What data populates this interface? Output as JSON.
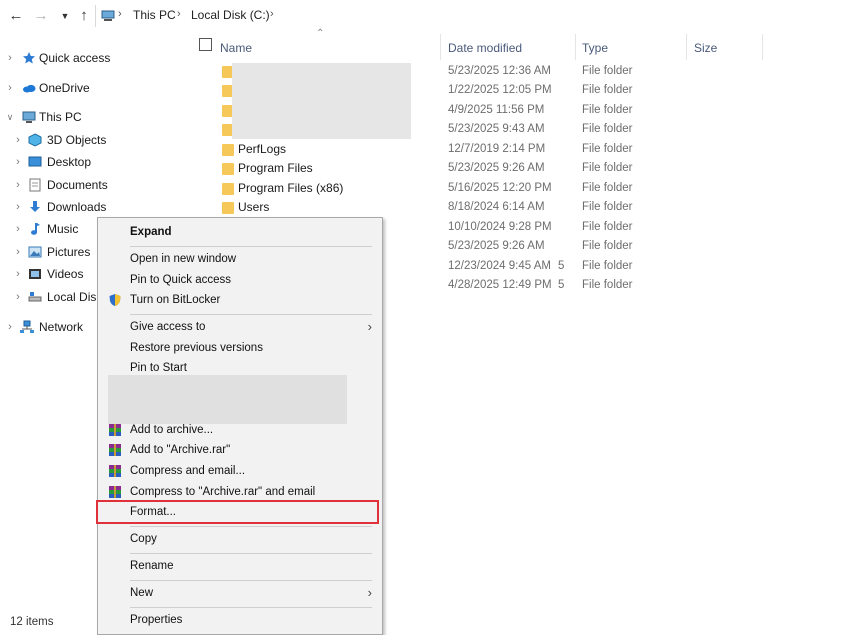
{
  "address": {
    "crumbs": [
      "This PC",
      "Local Disk (C:)"
    ]
  },
  "nav": {
    "items": [
      {
        "label": "Quick access",
        "icon": "star-icon"
      },
      {
        "label": "OneDrive",
        "icon": "cloud-icon"
      },
      {
        "label": "This PC",
        "icon": "computer-icon"
      },
      {
        "label": "3D Objects",
        "icon": "cube-icon"
      },
      {
        "label": "Desktop",
        "icon": "desktop-icon"
      },
      {
        "label": "Documents",
        "icon": "document-icon"
      },
      {
        "label": "Downloads",
        "icon": "download-icon"
      },
      {
        "label": "Music",
        "icon": "music-icon"
      },
      {
        "label": "Pictures",
        "icon": "picture-icon"
      },
      {
        "label": "Videos",
        "icon": "video-icon"
      },
      {
        "label": "Local Disk",
        "icon": "drive-icon"
      },
      {
        "label": "Network",
        "icon": "network-icon"
      }
    ]
  },
  "status": {
    "items_count": "12 items"
  },
  "columns": {
    "name": "Name",
    "date": "Date modified",
    "type": "Type",
    "size": "Size"
  },
  "rows": [
    {
      "name": "",
      "date": "5/23/2025 12:36 AM",
      "type": "File folder"
    },
    {
      "name": "",
      "date": "1/22/2025 12:05 PM",
      "type": "File folder"
    },
    {
      "name": "",
      "date": "4/9/2025 11:56 PM",
      "type": "File folder"
    },
    {
      "name": "",
      "date": "5/23/2025 9:43 AM",
      "type": "File folder"
    },
    {
      "name": "PerfLogs",
      "date": "12/7/2019 2:14 PM",
      "type": "File folder"
    },
    {
      "name": "Program Files",
      "date": "5/23/2025 9:26 AM",
      "type": "File folder"
    },
    {
      "name": "Program Files (x86)",
      "date": "5/16/2025 12:20 PM",
      "type": "File folder"
    },
    {
      "name": "Users",
      "date": "8/18/2024 6:14 AM",
      "type": "File folder"
    },
    {
      "name": "",
      "date": "10/10/2024 9:28 PM",
      "type": "File folder"
    },
    {
      "name": "",
      "date": "5/23/2025 9:26 AM",
      "type": "File folder"
    },
    {
      "name": "",
      "date": "12/23/2024 9:45 AM",
      "type": "File folder"
    },
    {
      "name": "",
      "date": "4/28/2025 12:49 PM",
      "type": "File folder"
    }
  ],
  "partial_chars": [
    "5",
    "5"
  ],
  "menu": {
    "expand": "Expand",
    "open_new_window": "Open in new window",
    "pin_quick_access": "Pin to Quick access",
    "bitlocker": "Turn on BitLocker",
    "give_access": "Give access to",
    "restore_versions": "Restore previous versions",
    "pin_start": "Pin to Start",
    "add_archive": "Add to archive...",
    "add_archive_rar": "Add to \"Archive.rar\"",
    "compress_email": "Compress and email...",
    "compress_rar_email": "Compress to \"Archive.rar\" and email",
    "format": "Format...",
    "copy": "Copy",
    "rename": "Rename",
    "new": "New",
    "properties": "Properties"
  },
  "colors": {
    "highlight": "#e0303a",
    "folder": "#f6c85a"
  }
}
